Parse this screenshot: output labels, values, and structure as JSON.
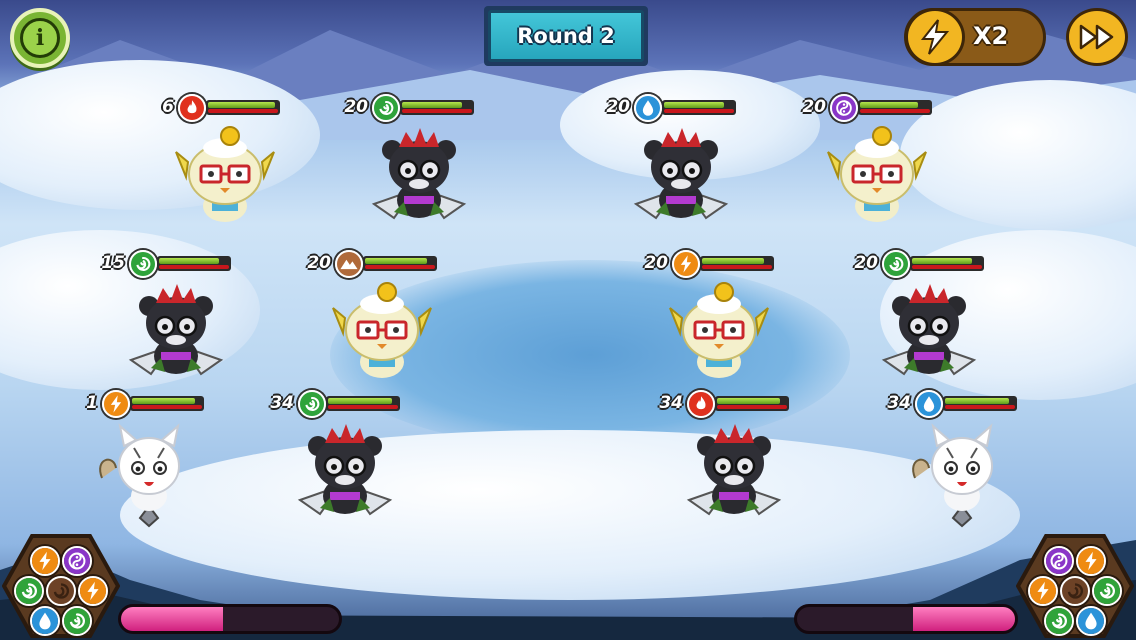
{
  "hud": {
    "round_label": "Round 2",
    "speed_label": "X2",
    "info_icon": "info-icon",
    "speed_icon": "lightning-icon",
    "fast_forward_icon": "fast-forward-icon"
  },
  "colors": {
    "fire": "#e0311e",
    "water": "#2b93d9",
    "nature": "#2fa33a",
    "lightning": "#ef8b12",
    "spirit": "#8a36c8",
    "earth": "#b06a3a",
    "health": "#7cc12b",
    "energy": "#c9171c",
    "special_bar": "#e23c96"
  },
  "left_team": [
    {
      "level": "6",
      "element": "fire",
      "species": "owl-sprite",
      "hp": 0.95
    },
    {
      "level": "15",
      "element": "nature",
      "species": "ninja-panda",
      "hp": 0.85
    },
    {
      "level": "1",
      "element": "lightning",
      "species": "snow-cat",
      "hp": 0.9
    },
    {
      "level": "20",
      "element": "nature",
      "species": "ninja-panda",
      "hp": 0.86
    },
    {
      "level": "20",
      "element": "earth",
      "species": "owl-sprite",
      "hp": 0.88
    },
    {
      "level": "34",
      "element": "nature",
      "species": "ninja-panda",
      "hp": 0.92
    }
  ],
  "right_team": [
    {
      "level": "20",
      "element": "water",
      "species": "ninja-panda",
      "hp": 0.85
    },
    {
      "level": "20",
      "element": "lightning",
      "species": "owl-sprite",
      "hp": 0.88
    },
    {
      "level": "34",
      "element": "fire",
      "species": "ninja-panda",
      "hp": 0.9
    },
    {
      "level": "20",
      "element": "spirit",
      "species": "owl-sprite",
      "hp": 0.83
    },
    {
      "level": "20",
      "element": "nature",
      "species": "ninja-panda",
      "hp": 0.86
    },
    {
      "level": "34",
      "element": "water",
      "species": "snow-cat",
      "hp": 0.92
    }
  ],
  "left_orbs": [
    "lightning",
    "spirit",
    "nature",
    "lightning",
    "water",
    "nature"
  ],
  "right_orbs": [
    "spirit",
    "lightning",
    "lightning",
    "nature",
    "nature",
    "water"
  ],
  "left_special_fill": 0.47,
  "right_special_fill": 0.47
}
